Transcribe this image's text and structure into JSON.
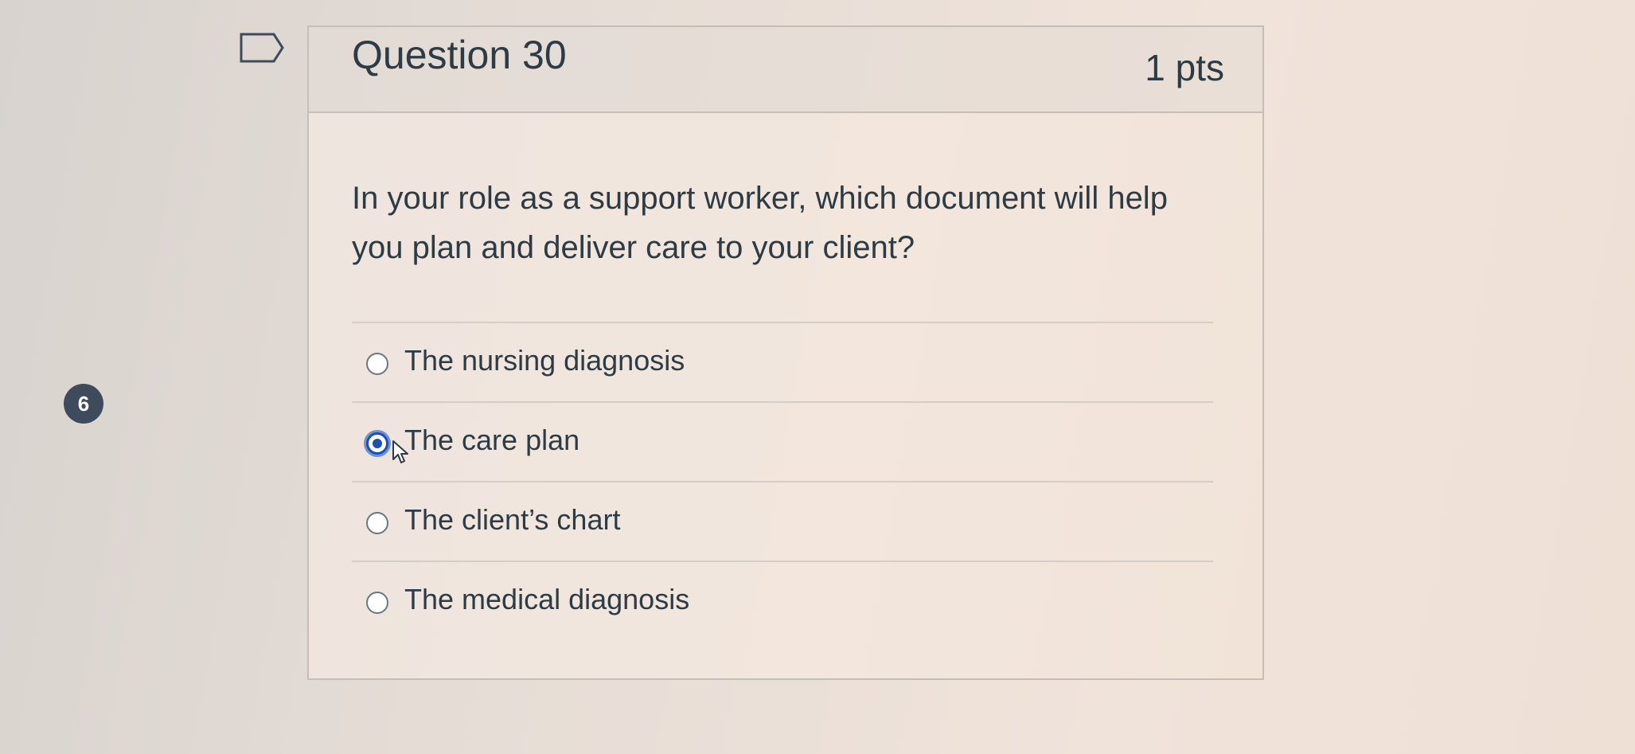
{
  "flag": {
    "icon": "flag-icon"
  },
  "status_bubble": {
    "number": "6"
  },
  "question": {
    "title": "Question 30",
    "points": "1 pts",
    "text": "In your role as a support worker, which document will help you plan and deliver care to your client?"
  },
  "answers": [
    {
      "label": "The nursing diagnosis",
      "selected": false
    },
    {
      "label": "The care plan",
      "selected": true
    },
    {
      "label": "The client’s chart",
      "selected": false
    },
    {
      "label": "The medical diagnosis",
      "selected": false
    }
  ],
  "colors": {
    "selected_radio": "#1e50b4",
    "text": "#2d3b45",
    "bubble": "#3d4b5c"
  }
}
